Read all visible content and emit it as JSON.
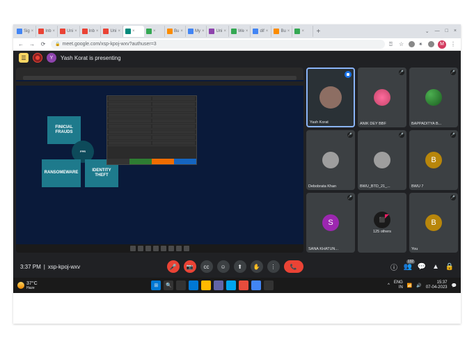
{
  "browser": {
    "tabs": [
      {
        "favicon": "fav-blue",
        "label": "Sig"
      },
      {
        "favicon": "fav-red",
        "label": "Inb"
      },
      {
        "favicon": "fav-red",
        "label": "Uni"
      },
      {
        "favicon": "fav-red",
        "label": "Inb"
      },
      {
        "favicon": "fav-red",
        "label": "Uni"
      },
      {
        "favicon": "fav-teal",
        "label": ""
      },
      {
        "favicon": "fav-green",
        "label": ""
      },
      {
        "favicon": "fav-orange",
        "label": "Bu"
      },
      {
        "favicon": "fav-blue",
        "label": "My"
      },
      {
        "favicon": "fav-purple",
        "label": "Uni"
      },
      {
        "favicon": "fav-green",
        "label": "We"
      },
      {
        "favicon": "fav-blue",
        "label": "dif"
      },
      {
        "favicon": "fav-orange",
        "label": "Bu"
      },
      {
        "favicon": "fav-green",
        "label": ""
      }
    ],
    "url": "meet.google.com/xsp-kpoj-wxv?authuser=3",
    "profile_initial": "M"
  },
  "meet": {
    "banner_text": "Yash Korat is presenting",
    "presenter_initial": "Y",
    "shared_screen": {
      "diagram_boxes": {
        "top_left": "FINICIAL\nFRAUDS",
        "bottom_left": "RANSOMEWARE",
        "bottom_right": "IDENTITY\nTHEFT",
        "center": "FPR"
      }
    },
    "participants": [
      {
        "name": "Yash Korat",
        "avatar_class": "av-face",
        "speaking": true
      },
      {
        "name": "ANIK DEY BBF",
        "avatar_class": "av-anik",
        "muted": true
      },
      {
        "name": "BAPPADITYA B...",
        "avatar_class": "av-bapp",
        "muted": true
      },
      {
        "name": "Debobrata Khan",
        "avatar_class": "av-debo",
        "muted": true
      },
      {
        "name": "BWU_BTD_21_...",
        "avatar_class": "av-bwu",
        "muted": true
      },
      {
        "name": "BWU 7",
        "avatar_class": "av-b",
        "initial": "B",
        "muted": true
      },
      {
        "name": "SANA KHATUN...",
        "avatar_class": "av-s",
        "initial": "S",
        "muted": true
      },
      {
        "name": "125 others",
        "avatar_class": "av-others",
        "initial": "",
        "muted": false
      },
      {
        "name": "You",
        "avatar_class": "av-b",
        "initial": "B",
        "muted": true
      }
    ],
    "others_count": "125 others",
    "controls": {
      "time": "3:37 PM",
      "code": "xsp-kpoj-wxv",
      "participant_badge": "132"
    }
  },
  "taskbar": {
    "weather_temp": "37°C",
    "weather_cond": "Haze",
    "lang": "ENG",
    "region": "IN",
    "time": "15:37",
    "date": "07-04-2023"
  }
}
